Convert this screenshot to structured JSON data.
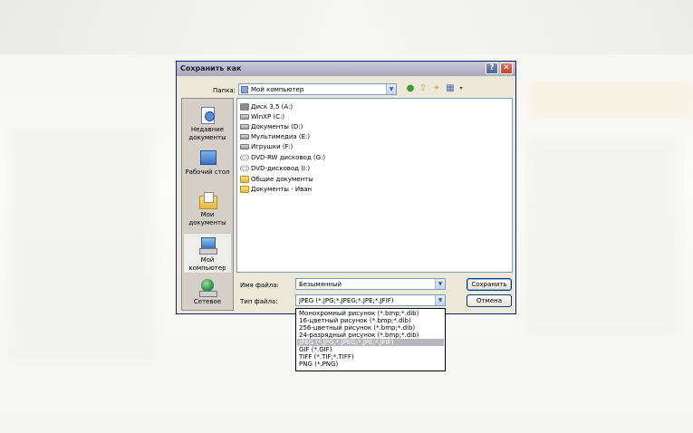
{
  "dialog": {
    "title": "Сохранить как",
    "help_label": "?",
    "close_label": "✕"
  },
  "lookin": {
    "label": "Папка:",
    "value": "Мой компьютер"
  },
  "places": [
    {
      "label": "Недавние документы",
      "icon": "recent-documents-icon"
    },
    {
      "label": "Рабочий стол",
      "icon": "desktop-icon"
    },
    {
      "label": "Мои документы",
      "icon": "my-documents-icon"
    },
    {
      "label": "Мой компьютер",
      "icon": "my-computer-icon"
    },
    {
      "label": "Сетевое",
      "icon": "network-icon"
    }
  ],
  "files": [
    {
      "label": "Диск 3,5 (A:)",
      "icon": "floppy-icon"
    },
    {
      "label": "WinXP (C:)",
      "icon": "drive-icon"
    },
    {
      "label": "Документы (D:)",
      "icon": "drive-icon"
    },
    {
      "label": "Мультимедиа (E:)",
      "icon": "drive-icon"
    },
    {
      "label": "Игрушки (F:)",
      "icon": "drive-icon"
    },
    {
      "label": "DVD-RW дисковод (G:)",
      "icon": "cd-icon"
    },
    {
      "label": "DVD-дисковод (I:)",
      "icon": "cd-icon"
    },
    {
      "label": "Общие документы",
      "icon": "folder-icon"
    },
    {
      "label": "Документы - Иван",
      "icon": "folder-icon"
    }
  ],
  "filename": {
    "label": "Имя файла:",
    "value": "Безымянный"
  },
  "filetype": {
    "label": "Тип файла:",
    "value": "JPEG (*.JPG;*.JPEG;*.JPE;*.JFIF)",
    "options": [
      "Монохромный рисунок (*.bmp;*.dib)",
      "16-цветный рисунок (*.bmp;*.dib)",
      "256-цветный рисунок (*.bmp;*.dib)",
      "24-разрядный рисунок (*.bmp;*.dib)",
      "JPEG (*.JPG;*.JPEG;*.JPE;*.JFIF)",
      "GIF (*.GIF)",
      "TIFF (*.TIF;*.TIFF)",
      "PNG (*.PNG)"
    ],
    "selected_index": 4
  },
  "buttons": {
    "save": "Сохранить",
    "cancel": "Отмена"
  },
  "colors": {
    "titlebar": "#b7b7c8",
    "dialog_bg": "#ece9d8",
    "selection": "#b6b6bc"
  }
}
